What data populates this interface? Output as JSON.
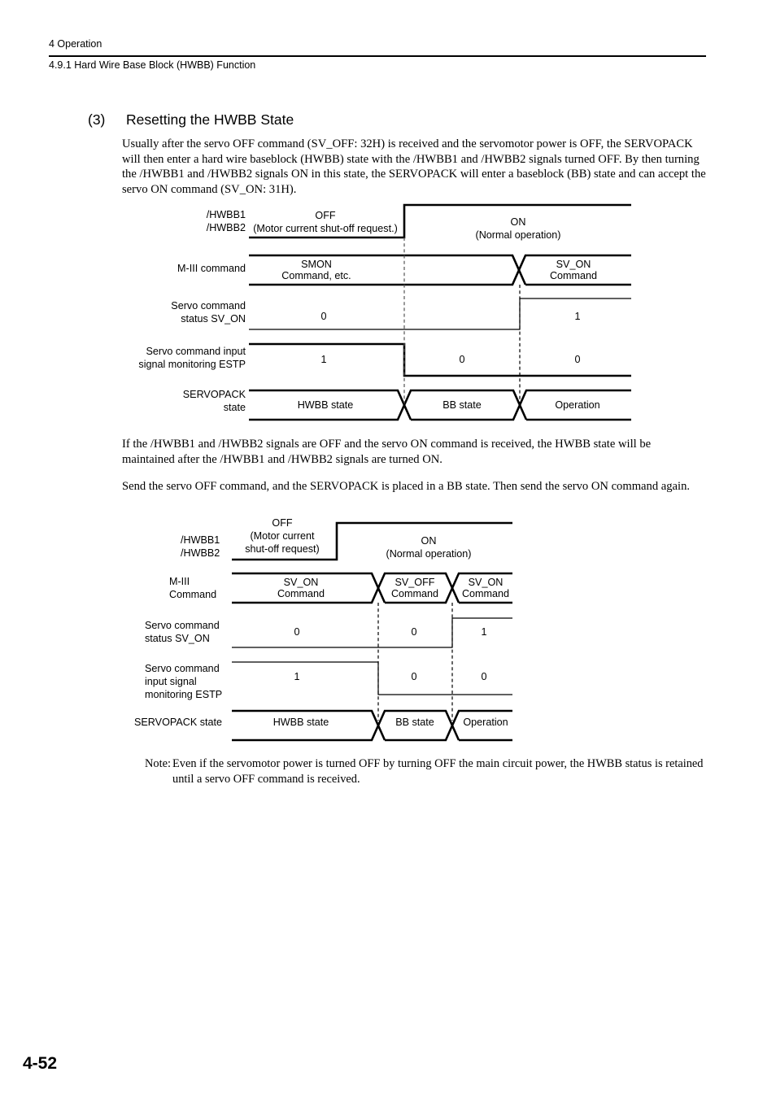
{
  "header": {
    "chapter": "4  Operation",
    "section": "4.9.1  Hard Wire Base Block (HWBB) Function"
  },
  "heading": {
    "number": "(3)",
    "title": "Resetting the HWBB State"
  },
  "paragraphs": {
    "intro": "Usually after the servo OFF command (SV_OFF: 32H) is received and the servomotor power is OFF, the SERVOPACK will then enter a hard wire baseblock (HWBB) state with the /HWBB1 and /HWBB2 signals turned OFF. By then turning the /HWBB1 and /HWBB2 signals ON in this state, the SERVOPACK will enter a baseblock (BB) state and can accept the servo ON command (SV_ON: 31H).",
    "mid1": "If the /HWBB1 and /HWBB2 signals are OFF and the servo ON command is received, the HWBB state will be maintained after the /HWBB1 and /HWBB2 signals are turned ON.",
    "mid2": "Send the servo OFF command, and the SERVOPACK is placed in a BB state. Then send the servo ON command again."
  },
  "note": {
    "label": "Note:",
    "body": "Even if the servomotor power is turned OFF by turning OFF the main circuit power, the HWBB status is retained until a servo OFF command is received."
  },
  "footer": {
    "page": "4-52"
  },
  "diagram1": {
    "rows": {
      "hwbb": {
        "label_line1": "/HWBB1",
        "label_line2": "/HWBB2",
        "off_title": "OFF",
        "off_sub": "(Motor current shut-off request.)",
        "on_title": "ON",
        "on_sub": "(Normal operation)"
      },
      "command": {
        "label": "M-III command",
        "seg1_line1": "SMON",
        "seg1_line2": "Command, etc.",
        "seg2_line1": "SV_ON",
        "seg2_line2": "Command"
      },
      "status": {
        "label_line1": "Servo command",
        "label_line2": "status SV_ON",
        "value_before": "0",
        "value_after": "1"
      },
      "estp": {
        "label_line1": "Servo command input",
        "label_line2": "signal monitoring ESTP",
        "value1": "1",
        "value2": "0",
        "value3": "0"
      },
      "state": {
        "label_line1": "SERVOPACK",
        "label_line2": "state",
        "seg1": "HWBB state",
        "seg2": "BB state",
        "seg3": "Operation"
      }
    }
  },
  "diagram2": {
    "rows": {
      "hwbb": {
        "label_line1": "/HWBB1",
        "label_line2": "/HWBB2",
        "off_title": "OFF",
        "off_sub1": "(Motor current",
        "off_sub2": "shut-off request)",
        "on_title": "ON",
        "on_sub": "(Normal operation)"
      },
      "command": {
        "label_line1": "M-III",
        "label_line2": "Command",
        "seg1_line1": "SV_ON",
        "seg1_line2": "Command",
        "seg2_line1": "SV_OFF",
        "seg2_line2": "Command",
        "seg3_line1": "SV_ON",
        "seg3_line2": "Command"
      },
      "status": {
        "label_line1": "Servo command",
        "label_line2": "status SV_ON",
        "value1": "0",
        "value2": "0",
        "value3": "1"
      },
      "estp": {
        "label_line1": "Servo command",
        "label_line2": "input signal",
        "label_line3": "monitoring ESTP",
        "value1": "1",
        "value2": "0",
        "value3": "0"
      },
      "state": {
        "label": "SERVOPACK state",
        "seg1": "HWBB state",
        "seg2": "BB state",
        "seg3": "Operation"
      }
    }
  }
}
